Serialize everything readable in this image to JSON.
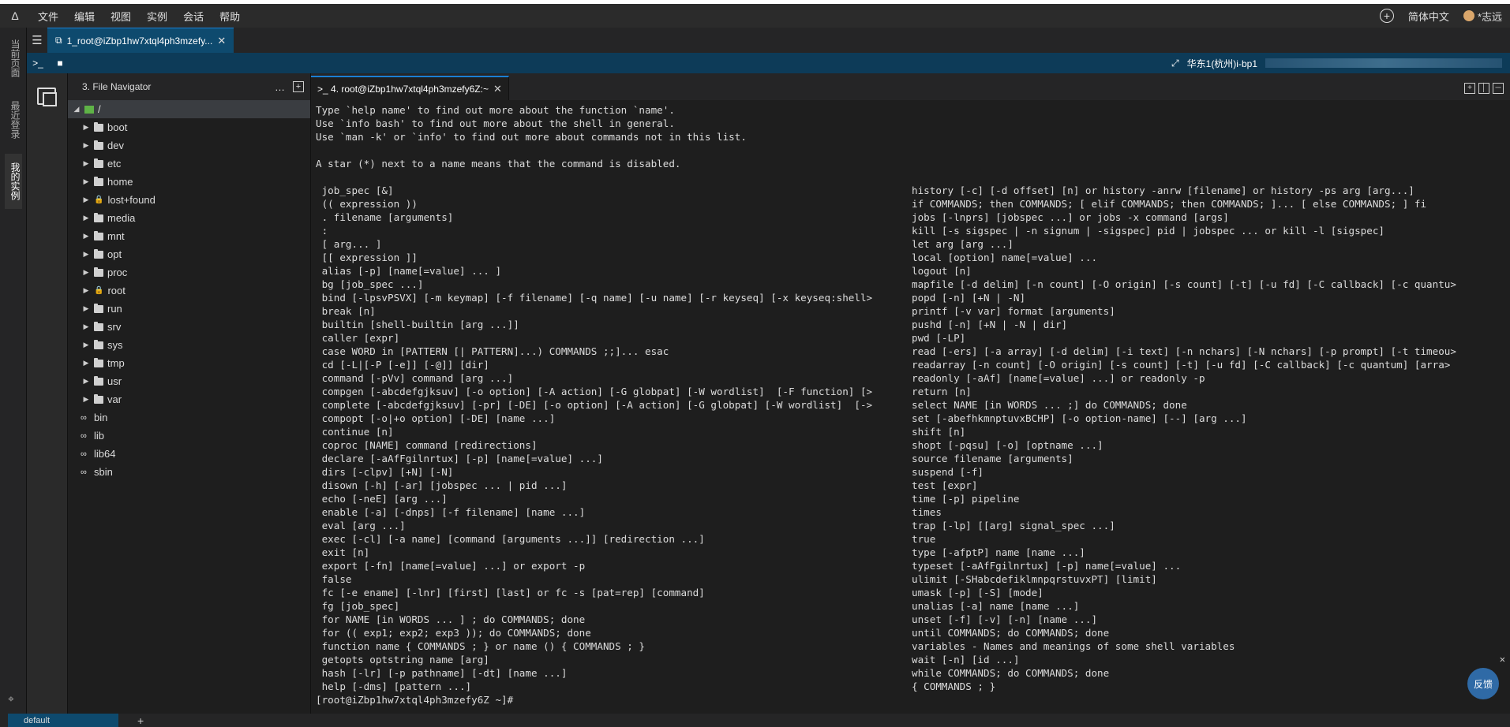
{
  "app": {
    "logo_glyph": "Δ",
    "menu": [
      "文件",
      "编辑",
      "视图",
      "实例",
      "会话",
      "帮助"
    ],
    "language": "简体中文",
    "user": "*志远"
  },
  "left_rail": {
    "items": [
      "当前页面",
      "最近登录",
      "我的实例"
    ]
  },
  "session_tab": {
    "label": "1_root@iZbp1hw7xtql4ph3mzefy...",
    "close": "✕"
  },
  "toolbar": {
    "host_label": "华东1(杭州)i-bp1"
  },
  "file_navigator": {
    "title": "3. File Navigator",
    "root": "/",
    "items": [
      {
        "name": "boot",
        "type": "folder"
      },
      {
        "name": "dev",
        "type": "folder"
      },
      {
        "name": "etc",
        "type": "folder"
      },
      {
        "name": "home",
        "type": "folder"
      },
      {
        "name": "lost+found",
        "type": "locked"
      },
      {
        "name": "media",
        "type": "folder"
      },
      {
        "name": "mnt",
        "type": "folder"
      },
      {
        "name": "opt",
        "type": "folder"
      },
      {
        "name": "proc",
        "type": "folder"
      },
      {
        "name": "root",
        "type": "locked"
      },
      {
        "name": "run",
        "type": "folder"
      },
      {
        "name": "srv",
        "type": "folder"
      },
      {
        "name": "sys",
        "type": "folder"
      },
      {
        "name": "tmp",
        "type": "folder"
      },
      {
        "name": "usr",
        "type": "folder"
      },
      {
        "name": "var",
        "type": "folder"
      },
      {
        "name": "bin",
        "type": "link"
      },
      {
        "name": "lib",
        "type": "link"
      },
      {
        "name": "lib64",
        "type": "link"
      },
      {
        "name": "sbin",
        "type": "link"
      }
    ]
  },
  "terminal_tab": {
    "label": ">_ 4. root@iZbp1hw7xtql4ph3mzefy6Z:~",
    "close": "✕"
  },
  "terminal": {
    "intro": [
      "Type `help name' to find out more about the function `name'.",
      "Use `info bash' to find out more about the shell in general.",
      "Use `man -k' or `info' to find out more about commands not in this list.",
      "",
      "A star (*) next to a name means that the command is disabled.",
      ""
    ],
    "left": [
      " job_spec [&]",
      " (( expression ))",
      " . filename [arguments]",
      " :",
      " [ arg... ]",
      " [[ expression ]]",
      " alias [-p] [name[=value] ... ]",
      " bg [job_spec ...]",
      " bind [-lpsvPSVX] [-m keymap] [-f filename] [-q name] [-u name] [-r keyseq] [-x keyseq:shell>",
      " break [n]",
      " builtin [shell-builtin [arg ...]]",
      " caller [expr]",
      " case WORD in [PATTERN [| PATTERN]...) COMMANDS ;;]... esac",
      " cd [-L|[-P [-e]] [-@]] [dir]",
      " command [-pVv] command [arg ...]",
      " compgen [-abcdefgjksuv] [-o option] [-A action] [-G globpat] [-W wordlist]  [-F function] [>",
      " complete [-abcdefgjksuv] [-pr] [-DE] [-o option] [-A action] [-G globpat] [-W wordlist]  [->",
      " compopt [-o|+o option] [-DE] [name ...]",
      " continue [n]",
      " coproc [NAME] command [redirections]",
      " declare [-aAfFgilnrtux] [-p] [name[=value] ...]",
      " dirs [-clpv] [+N] [-N]",
      " disown [-h] [-ar] [jobspec ... | pid ...]",
      " echo [-neE] [arg ...]",
      " enable [-a] [-dnps] [-f filename] [name ...]",
      " eval [arg ...]",
      " exec [-cl] [-a name] [command [arguments ...]] [redirection ...]",
      " exit [n]",
      " export [-fn] [name[=value] ...] or export -p",
      " false",
      " fc [-e ename] [-lnr] [first] [last] or fc -s [pat=rep] [command]",
      " fg [job_spec]",
      " for NAME [in WORDS ... ] ; do COMMANDS; done",
      " for (( exp1; exp2; exp3 )); do COMMANDS; done",
      " function name { COMMANDS ; } or name () { COMMANDS ; }",
      " getopts optstring name [arg]",
      " hash [-lr] [-p pathname] [-dt] [name ...]",
      " help [-dms] [pattern ...]"
    ],
    "right": [
      "history [-c] [-d offset] [n] or history -anrw [filename] or history -ps arg [arg...]",
      "if COMMANDS; then COMMANDS; [ elif COMMANDS; then COMMANDS; ]... [ else COMMANDS; ] fi",
      "jobs [-lnprs] [jobspec ...] or jobs -x command [args]",
      "kill [-s sigspec | -n signum | -sigspec] pid | jobspec ... or kill -l [sigspec]",
      "let arg [arg ...]",
      "local [option] name[=value] ...",
      "logout [n]",
      "mapfile [-d delim] [-n count] [-O origin] [-s count] [-t] [-u fd] [-C callback] [-c quantu>",
      "popd [-n] [+N | -N]",
      "printf [-v var] format [arguments]",
      "pushd [-n] [+N | -N | dir]",
      "pwd [-LP]",
      "read [-ers] [-a array] [-d delim] [-i text] [-n nchars] [-N nchars] [-p prompt] [-t timeou>",
      "readarray [-n count] [-O origin] [-s count] [-t] [-u fd] [-C callback] [-c quantum] [arra>",
      "readonly [-aAf] [name[=value] ...] or readonly -p",
      "return [n]",
      "select NAME [in WORDS ... ;] do COMMANDS; done",
      "set [-abefhkmnptuvxBCHP] [-o option-name] [--] [arg ...]",
      "shift [n]",
      "shopt [-pqsu] [-o] [optname ...]",
      "source filename [arguments]",
      "suspend [-f]",
      "test [expr]",
      "time [-p] pipeline",
      "times",
      "trap [-lp] [[arg] signal_spec ...]",
      "true",
      "type [-afptP] name [name ...]",
      "typeset [-aAfFgilnrtux] [-p] name[=value] ...",
      "ulimit [-SHabcdefiklmnpqrstuvxPT] [limit]",
      "umask [-p] [-S] [mode]",
      "unalias [-a] name [name ...]",
      "unset [-f] [-v] [-n] [name ...]",
      "until COMMANDS; do COMMANDS; done",
      "variables - Names and meanings of some shell variables",
      "wait [-n] [id ...]",
      "while COMMANDS; do COMMANDS; done",
      "{ COMMANDS ; }"
    ],
    "prompt": "[root@iZbp1hw7xtql4ph3mzefy6Z ~]#"
  },
  "feedback": "反馈",
  "status": {
    "tab": "default",
    "add": "+"
  }
}
